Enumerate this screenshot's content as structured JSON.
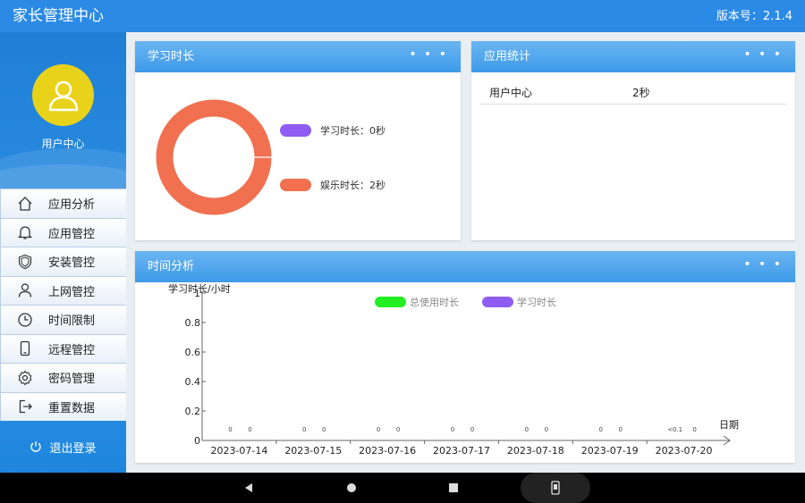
{
  "header": {
    "title": "家长管理中心",
    "version": "版本号：2.1.4"
  },
  "sidebar": {
    "profile_name": "用户中心",
    "items": [
      {
        "label": "应用分析",
        "icon": "home-icon"
      },
      {
        "label": "应用管控",
        "icon": "bell-icon"
      },
      {
        "label": "安装管控",
        "icon": "shield-icon"
      },
      {
        "label": "上网管控",
        "icon": "user-icon"
      },
      {
        "label": "时间限制",
        "icon": "clock-icon"
      },
      {
        "label": "远程管控",
        "icon": "phone-icon"
      },
      {
        "label": "密码管理",
        "icon": "gear-icon"
      },
      {
        "label": "重置数据",
        "icon": "exit-icon"
      }
    ],
    "logout": "退出登录"
  },
  "study_card": {
    "title": "学习时长",
    "more": "• • •",
    "legend": [
      {
        "label": "学习时长：0秒",
        "color": "#8f5cf2"
      },
      {
        "label": "娱乐时长：2秒",
        "color": "#f07050"
      }
    ]
  },
  "app_card": {
    "title": "应用统计",
    "more": "• • •",
    "rows": [
      {
        "name": "用户中心",
        "value": "2秒"
      }
    ]
  },
  "time_card": {
    "title": "时间分析",
    "more": "• • •"
  },
  "colors": {
    "accent": "#2b8ae6",
    "study": "#8f5cf2",
    "entertainment": "#f07050",
    "total": "#22ee22"
  },
  "chart_data": [
    {
      "type": "pie",
      "labels": [
        "学习时长",
        "娱乐时长"
      ],
      "values": [
        0,
        2
      ],
      "colors": [
        "#8f5cf2",
        "#f07050"
      ]
    },
    {
      "type": "bar",
      "ylabel": "学习时长/小时",
      "xlabel": "日期",
      "ylim": [
        0,
        1
      ],
      "yticks": [
        "0",
        "0.2",
        "0.4",
        "0.6",
        "0.8",
        "1"
      ],
      "categories": [
        "2023-07-14",
        "2023-07-15",
        "2023-07-16",
        "2023-07-17",
        "2023-07-18",
        "2023-07-19",
        "2023-07-20"
      ],
      "series": [
        {
          "name": "总使用时长",
          "color": "#22ee22",
          "values": [
            0,
            0,
            0,
            0,
            0,
            0,
            0
          ],
          "labels": [
            "0",
            "0",
            "0",
            "0",
            "0",
            "0",
            "<0.1"
          ]
        },
        {
          "name": "学习时长",
          "color": "#8f5cf2",
          "values": [
            0,
            0,
            0,
            0,
            0,
            0,
            0
          ],
          "labels": [
            "0",
            "0",
            "0",
            "0",
            "0",
            "0",
            "0"
          ]
        }
      ]
    }
  ]
}
